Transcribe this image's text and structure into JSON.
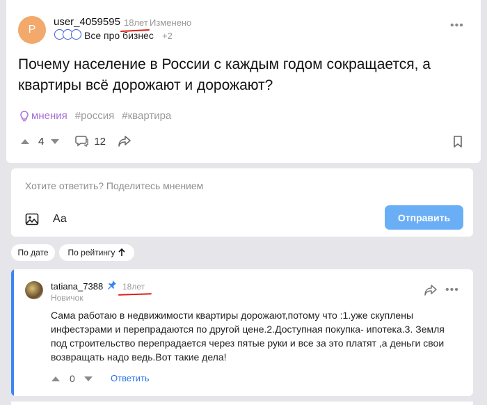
{
  "post": {
    "avatar_letter": "P",
    "avatar_color": "#f2a96b",
    "username": "user_4059595",
    "age_badge": "18лет",
    "edited": "Изменено",
    "community": "Все про бизнес",
    "community_more": "+2",
    "title": "Почему население в России с каждым годом сокращается, а квартиры всё дорожают и дорожают?",
    "tags": [
      "мнения",
      "#россия",
      "#квартира"
    ],
    "votes": "4",
    "comments": "12"
  },
  "reply_box": {
    "placeholder": "Хотите ответить? Поделитесь мнением",
    "format_label": "Аа",
    "send_label": "Отправить"
  },
  "sort": {
    "by_date": "По дате",
    "by_rating": "По рейтингу"
  },
  "comment": {
    "username": "tatiana_7388",
    "age_badge": "18лет",
    "rank": "Новичок",
    "text": "Сама работаю в недвижимости квартиры дорожают,потому что :1.уже скуплены инфестэрами и перепрадаются по другой цене.2.Доступная покупка- ипотека.3. Земля под строительство перепрадается через пятые руки и все за это платят ,а деньги свои возвращать надо ведь.Вот такие дела!",
    "votes": "0",
    "reply_label": "Ответить"
  },
  "colors": {
    "accent": "#3a86f5",
    "send_button": "#6aaef6",
    "tag_opinion": "#a66fd6",
    "highlight_underline": "#e21b1b"
  }
}
